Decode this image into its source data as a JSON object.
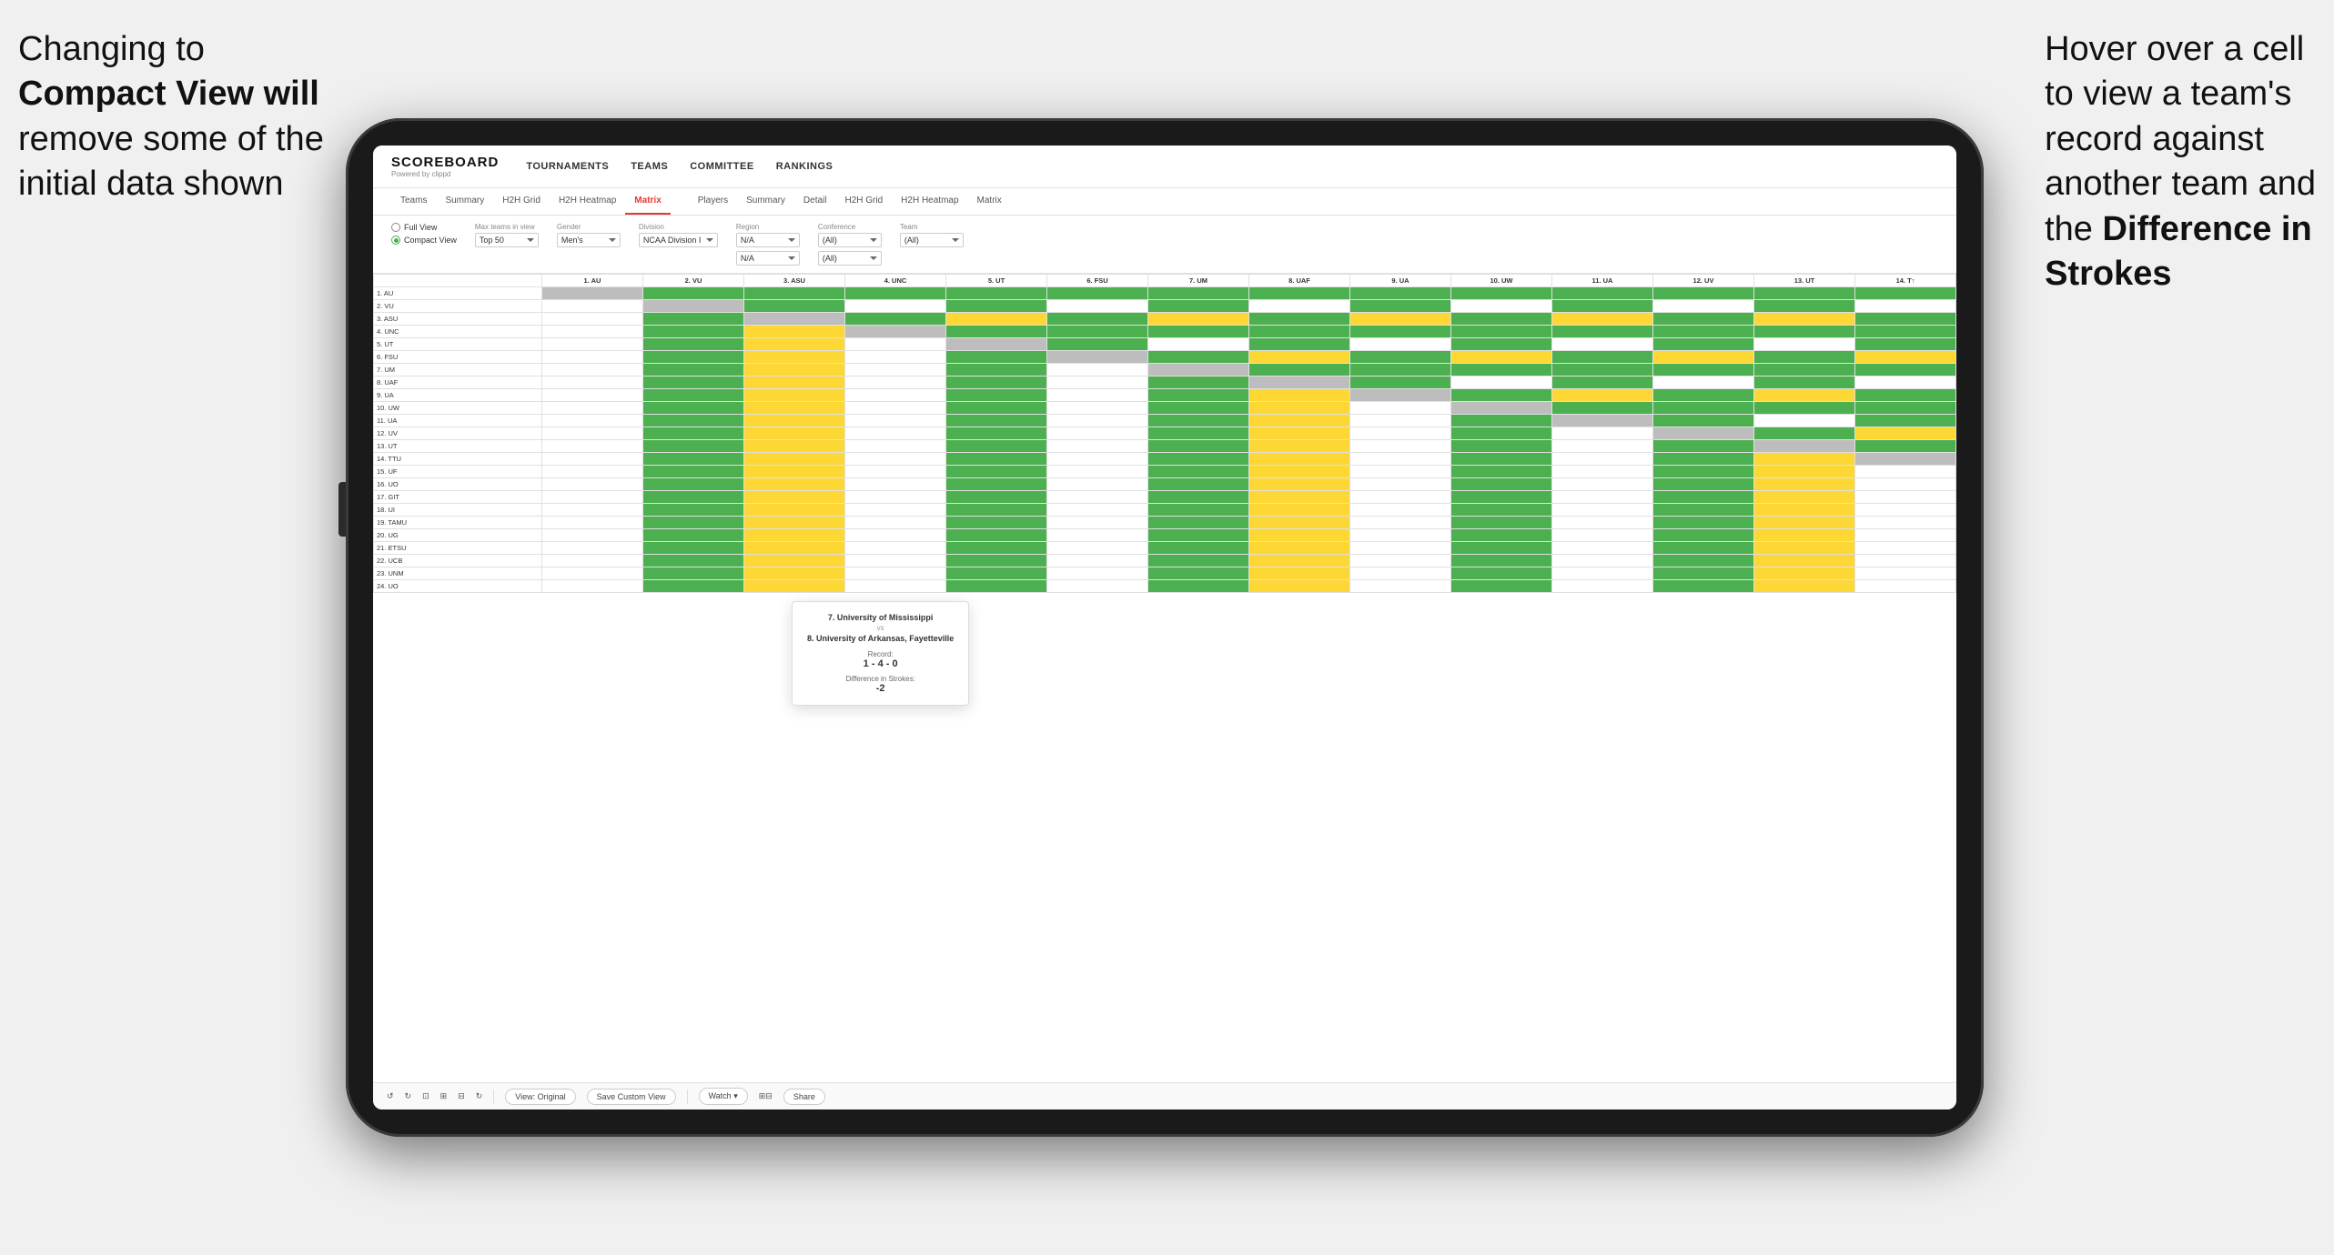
{
  "annotations": {
    "left_text_line1": "Changing to",
    "left_text_line2": "Compact View will",
    "left_text_line3": "remove some of the",
    "left_text_line4": "initial data shown",
    "right_text_line1": "Hover over a cell",
    "right_text_line2": "to view a team's",
    "right_text_line3": "record against",
    "right_text_line4": "another team and",
    "right_text_line5": "the",
    "right_text_bold": "Difference in",
    "right_text_bold2": "Strokes"
  },
  "nav": {
    "logo": "SCOREBOARD",
    "logo_sub": "Powered by clippd",
    "items": [
      "TOURNAMENTS",
      "TEAMS",
      "COMMITTEE",
      "RANKINGS"
    ]
  },
  "sub_nav": {
    "groups": [
      {
        "items": [
          "Teams",
          "Summary",
          "H2H Grid",
          "H2H Heatmap",
          "Matrix"
        ]
      },
      {
        "items": [
          "Players",
          "Summary",
          "Detail",
          "H2H Grid",
          "H2H Heatmap",
          "Matrix"
        ]
      }
    ],
    "active": "Matrix"
  },
  "controls": {
    "view_options": [
      "Full View",
      "Compact View"
    ],
    "selected_view": "Compact View",
    "filters": [
      {
        "label": "Max teams in view",
        "value": "Top 50"
      },
      {
        "label": "Gender",
        "value": "Men's"
      },
      {
        "label": "Division",
        "value": "NCAA Division I"
      },
      {
        "label": "Region",
        "value": "N/A",
        "value2": "N/A"
      },
      {
        "label": "Conference",
        "value": "(All)",
        "value2": "(All)"
      },
      {
        "label": "Team",
        "value": "(All)"
      }
    ]
  },
  "matrix": {
    "col_headers": [
      "1. AU",
      "2. VU",
      "3. ASU",
      "4. UNC",
      "5. UT",
      "6. FSU",
      "7. UM",
      "8. UAF",
      "9. UA",
      "10. UW",
      "11. UA",
      "12. UV",
      "13. UT",
      "14. T↑"
    ],
    "rows": [
      {
        "label": "1. AU",
        "cells": [
          "x",
          "g",
          "g",
          "g",
          "g",
          "g",
          "g",
          "g",
          "g",
          "g",
          "g",
          "g",
          "g",
          "g"
        ]
      },
      {
        "label": "2. VU",
        "cells": [
          "y",
          "x",
          "g",
          "y",
          "g",
          "g",
          "g",
          "g",
          "g",
          "g",
          "y",
          "g",
          "g",
          "g"
        ]
      },
      {
        "label": "3. ASU",
        "cells": [
          "y",
          "y",
          "x",
          "g",
          "y",
          "y",
          "g",
          "g",
          "g",
          "g",
          "g",
          "g",
          "y",
          "g"
        ]
      },
      {
        "label": "4. UNC",
        "cells": [
          "w",
          "g",
          "y",
          "x",
          "g",
          "g",
          "g",
          "g",
          "g",
          "g",
          "g",
          "g",
          "g",
          "g"
        ]
      },
      {
        "label": "5. UT",
        "cells": [
          "y",
          "y",
          "g",
          "y",
          "x",
          "y",
          "y",
          "y",
          "g",
          "g",
          "g",
          "g",
          "g",
          "g"
        ]
      },
      {
        "label": "6. FSU",
        "cells": [
          "w",
          "w",
          "g",
          "w",
          "g",
          "x",
          "g",
          "g",
          "y",
          "g",
          "g",
          "g",
          "g",
          "g"
        ]
      },
      {
        "label": "7. UM",
        "cells": [
          "w",
          "w",
          "w",
          "w",
          "g",
          "w",
          "x",
          "y",
          "y",
          "g",
          "g",
          "g",
          "g",
          "g"
        ]
      },
      {
        "label": "8. UAF",
        "cells": [
          "w",
          "w",
          "w",
          "w",
          "g",
          "w",
          "g",
          "x",
          "w",
          "g",
          "g",
          "y",
          "g",
          "g"
        ]
      },
      {
        "label": "9. UA",
        "cells": [
          "w",
          "w",
          "w",
          "w",
          "w",
          "y",
          "y",
          "g",
          "x",
          "g",
          "g",
          "g",
          "g",
          "g"
        ]
      },
      {
        "label": "10. UW",
        "cells": [
          "g",
          "g",
          "g",
          "g",
          "g",
          "g",
          "g",
          "g",
          "g",
          "x",
          "g",
          "g",
          "g",
          "g"
        ]
      },
      {
        "label": "11. UA",
        "cells": [
          "g",
          "g",
          "g",
          "g",
          "g",
          "g",
          "g",
          "g",
          "g",
          "y",
          "x",
          "g",
          "g",
          "g"
        ]
      },
      {
        "label": "12. UV",
        "cells": [
          "w",
          "w",
          "y",
          "w",
          "g",
          "g",
          "g",
          "g",
          "g",
          "g",
          "g",
          "x",
          "g",
          "g"
        ]
      },
      {
        "label": "13. UT",
        "cells": [
          "w",
          "w",
          "w",
          "w",
          "g",
          "g",
          "g",
          "g",
          "g",
          "g",
          "g",
          "g",
          "x",
          "g"
        ]
      },
      {
        "label": "14. TTU",
        "cells": [
          "w",
          "w",
          "w",
          "w",
          "w",
          "g",
          "g",
          "g",
          "g",
          "g",
          "g",
          "g",
          "g",
          "x"
        ]
      },
      {
        "label": "15. UF",
        "cells": [
          "w",
          "g",
          "g",
          "w",
          "g",
          "g",
          "g",
          "g",
          "g",
          "g",
          "g",
          "g",
          "g",
          "g"
        ]
      },
      {
        "label": "16. UO",
        "cells": [
          "w",
          "w",
          "w",
          "w",
          "g",
          "g",
          "g",
          "g",
          "g",
          "g",
          "g",
          "g",
          "g",
          "g"
        ]
      },
      {
        "label": "17. GIT",
        "cells": [
          "w",
          "w",
          "w",
          "w",
          "g",
          "g",
          "g",
          "g",
          "g",
          "g",
          "g",
          "g",
          "g",
          "g"
        ]
      },
      {
        "label": "18. UI",
        "cells": [
          "w",
          "w",
          "g",
          "w",
          "g",
          "g",
          "g",
          "g",
          "g",
          "g",
          "g",
          "g",
          "g",
          "g"
        ]
      },
      {
        "label": "19. TAMU",
        "cells": [
          "g",
          "g",
          "g",
          "g",
          "g",
          "g",
          "g",
          "g",
          "g",
          "g",
          "g",
          "g",
          "g",
          "g"
        ]
      },
      {
        "label": "20. UG",
        "cells": [
          "w",
          "g",
          "y",
          "w",
          "g",
          "g",
          "g",
          "g",
          "g",
          "g",
          "g",
          "g",
          "y",
          "g"
        ]
      },
      {
        "label": "21. ETSU",
        "cells": [
          "w",
          "w",
          "w",
          "w",
          "g",
          "g",
          "g",
          "g",
          "g",
          "g",
          "g",
          "g",
          "g",
          "g"
        ]
      },
      {
        "label": "22. UCB",
        "cells": [
          "w",
          "w",
          "w",
          "w",
          "g",
          "g",
          "g",
          "g",
          "g",
          "g",
          "g",
          "g",
          "g",
          "g"
        ]
      },
      {
        "label": "23. UNM",
        "cells": [
          "w",
          "w",
          "g",
          "w",
          "g",
          "g",
          "g",
          "g",
          "g",
          "g",
          "g",
          "g",
          "g",
          "g"
        ]
      },
      {
        "label": "24. UO",
        "cells": [
          "g",
          "g",
          "g",
          "g",
          "g",
          "g",
          "g",
          "g",
          "g",
          "g",
          "g",
          "g",
          "g",
          "g"
        ]
      }
    ]
  },
  "tooltip": {
    "team1": "7. University of Mississippi",
    "vs": "vs",
    "team2": "8. University of Arkansas, Fayetteville",
    "record_label": "Record:",
    "record_value": "1 - 4 - 0",
    "diff_label": "Difference in Strokes:",
    "diff_value": "-2"
  },
  "toolbar": {
    "buttons": [
      "↺",
      "↻",
      "⊡",
      "⊞",
      "⊟",
      "↺"
    ],
    "view_original": "View: Original",
    "save_custom": "Save Custom View",
    "watch": "Watch ▾",
    "share": "Share"
  }
}
